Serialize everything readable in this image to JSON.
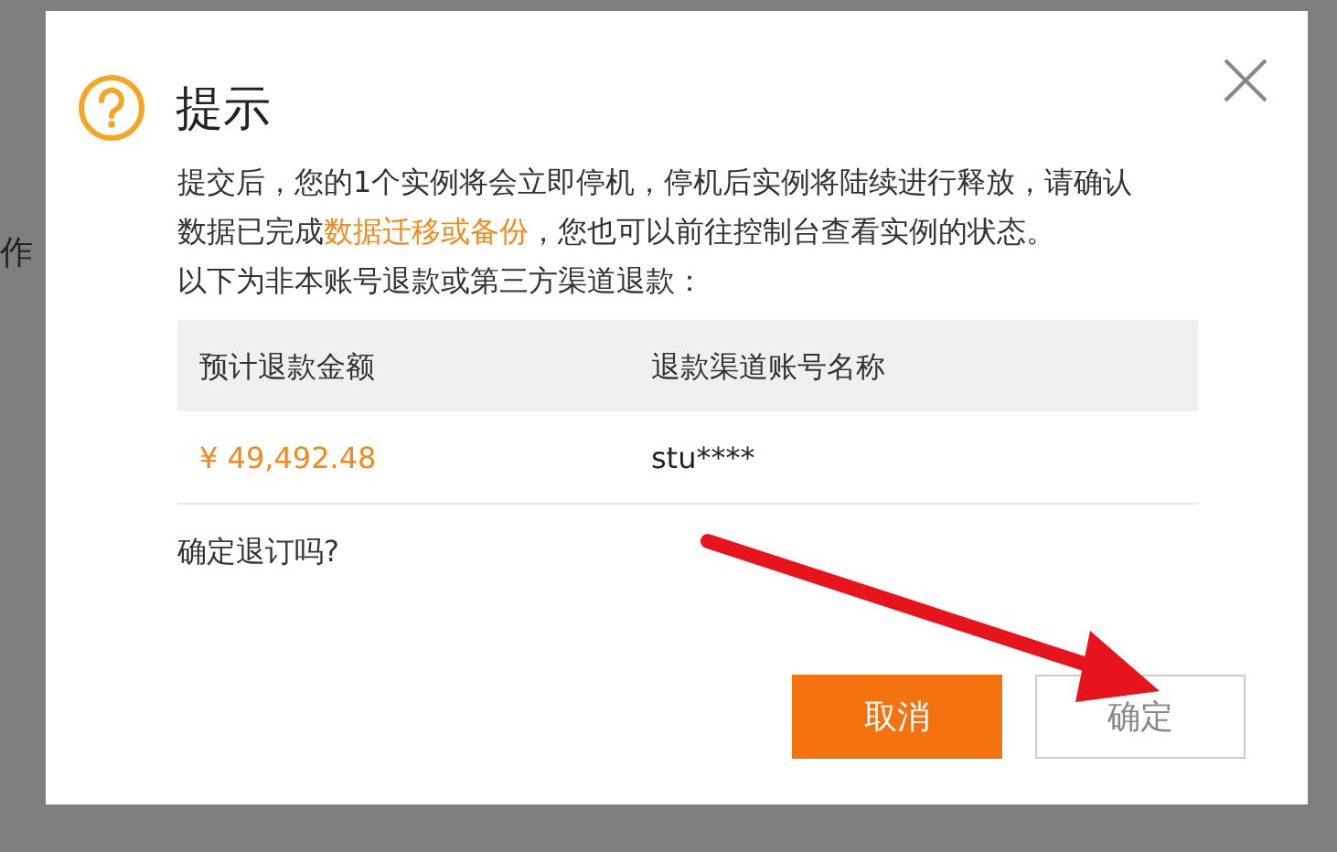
{
  "background": {
    "side_text": "作"
  },
  "dialog": {
    "title": "提示",
    "message": {
      "before": "提交后，您的1个实例将会立即停机，停机后实例将陆续进行释放，请确认数据已完成",
      "link": "数据迁移或备份",
      "after": "，您也可以前往控制台查看实例的状态。"
    },
    "note": "以下为非本账号退款或第三方渠道退款：",
    "table": {
      "columns": [
        "预计退款金额",
        "退款渠道账号名称"
      ],
      "rows": [
        [
          "¥ 49,492.48",
          "stu****"
        ]
      ]
    },
    "question": "确定退订吗?",
    "buttons": [
      {
        "label": "取消",
        "kind": "primary"
      },
      {
        "label": "确定",
        "kind": "secondary"
      }
    ]
  }
}
